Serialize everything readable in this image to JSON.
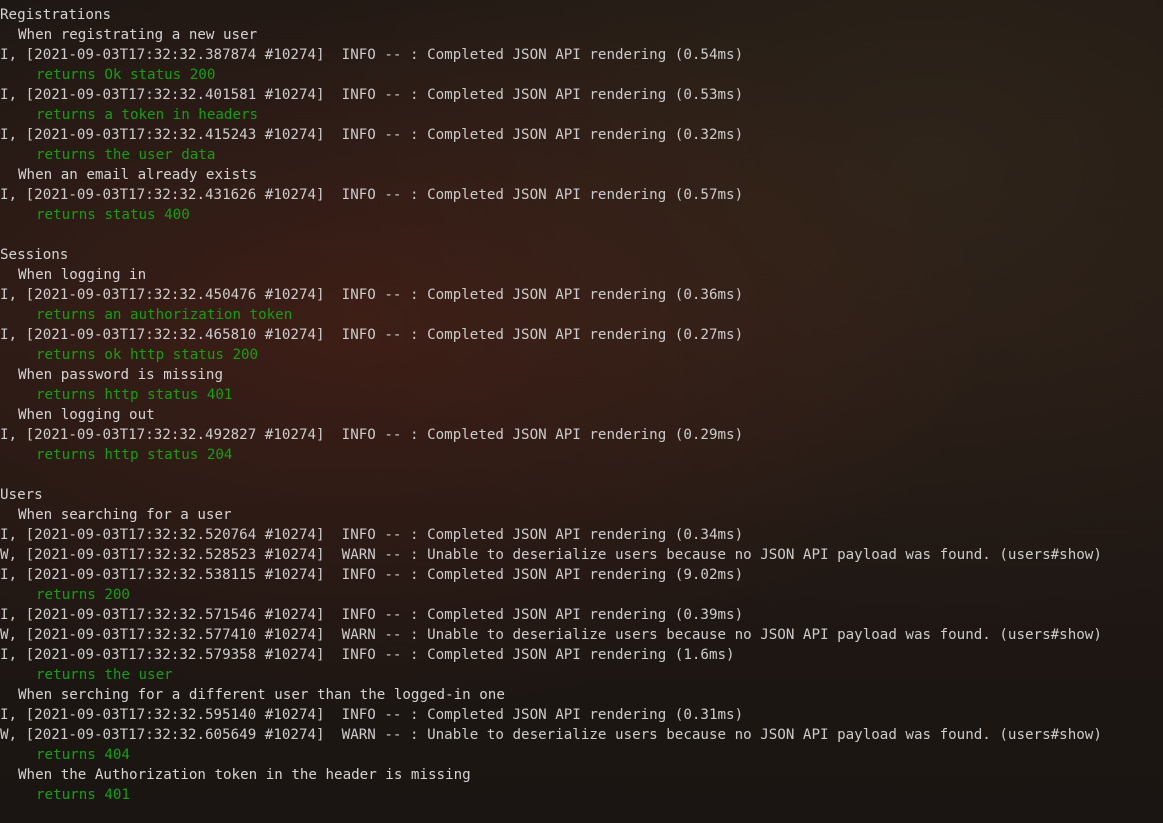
{
  "colors": {
    "background": "#1b1612",
    "text": "#cccccc",
    "pass": "#13a10e"
  },
  "lines": [
    {
      "kind": "suite",
      "text": "Registrations"
    },
    {
      "kind": "context",
      "text": "When registrating a new user"
    },
    {
      "kind": "log",
      "text": "I, [2021-09-03T17:32:32.387874 #10274]  INFO -- : Completed JSON API rendering (0.54ms)"
    },
    {
      "kind": "pass",
      "text": "returns Ok status 200"
    },
    {
      "kind": "log",
      "text": "I, [2021-09-03T17:32:32.401581 #10274]  INFO -- : Completed JSON API rendering (0.53ms)"
    },
    {
      "kind": "pass",
      "text": "returns a token in headers"
    },
    {
      "kind": "log",
      "text": "I, [2021-09-03T17:32:32.415243 #10274]  INFO -- : Completed JSON API rendering (0.32ms)"
    },
    {
      "kind": "pass",
      "text": "returns the user data"
    },
    {
      "kind": "context",
      "text": "When an email already exists"
    },
    {
      "kind": "log",
      "text": "I, [2021-09-03T17:32:32.431626 #10274]  INFO -- : Completed JSON API rendering (0.57ms)"
    },
    {
      "kind": "pass",
      "text": "returns status 400"
    },
    {
      "kind": "blank",
      "text": ""
    },
    {
      "kind": "suite",
      "text": "Sessions"
    },
    {
      "kind": "context",
      "text": "When logging in"
    },
    {
      "kind": "log",
      "text": "I, [2021-09-03T17:32:32.450476 #10274]  INFO -- : Completed JSON API rendering (0.36ms)"
    },
    {
      "kind": "pass",
      "text": "returns an authorization token"
    },
    {
      "kind": "log",
      "text": "I, [2021-09-03T17:32:32.465810 #10274]  INFO -- : Completed JSON API rendering (0.27ms)"
    },
    {
      "kind": "pass",
      "text": "returns ok http status 200"
    },
    {
      "kind": "context",
      "text": "When password is missing"
    },
    {
      "kind": "pass",
      "text": "returns http status 401"
    },
    {
      "kind": "context",
      "text": "When logging out"
    },
    {
      "kind": "log",
      "text": "I, [2021-09-03T17:32:32.492827 #10274]  INFO -- : Completed JSON API rendering (0.29ms)"
    },
    {
      "kind": "pass",
      "text": "returns http status 204"
    },
    {
      "kind": "blank",
      "text": ""
    },
    {
      "kind": "suite",
      "text": "Users"
    },
    {
      "kind": "context",
      "text": "When searching for a user"
    },
    {
      "kind": "log",
      "text": "I, [2021-09-03T17:32:32.520764 #10274]  INFO -- : Completed JSON API rendering (0.34ms)"
    },
    {
      "kind": "log",
      "text": "W, [2021-09-03T17:32:32.528523 #10274]  WARN -- : Unable to deserialize users because no JSON API payload was found. (users#show)"
    },
    {
      "kind": "log",
      "text": "I, [2021-09-03T17:32:32.538115 #10274]  INFO -- : Completed JSON API rendering (9.02ms)"
    },
    {
      "kind": "pass",
      "text": "returns 200"
    },
    {
      "kind": "log",
      "text": "I, [2021-09-03T17:32:32.571546 #10274]  INFO -- : Completed JSON API rendering (0.39ms)"
    },
    {
      "kind": "log",
      "text": "W, [2021-09-03T17:32:32.577410 #10274]  WARN -- : Unable to deserialize users because no JSON API payload was found. (users#show)"
    },
    {
      "kind": "log",
      "text": "I, [2021-09-03T17:32:32.579358 #10274]  INFO -- : Completed JSON API rendering (1.6ms)"
    },
    {
      "kind": "pass",
      "text": "returns the user"
    },
    {
      "kind": "context",
      "text": "When serching for a different user than the logged-in one"
    },
    {
      "kind": "log",
      "text": "I, [2021-09-03T17:32:32.595140 #10274]  INFO -- : Completed JSON API rendering (0.31ms)"
    },
    {
      "kind": "log",
      "text": "W, [2021-09-03T17:32:32.605649 #10274]  WARN -- : Unable to deserialize users because no JSON API payload was found. (users#show)"
    },
    {
      "kind": "pass",
      "text": "returns 404"
    },
    {
      "kind": "context",
      "text": "When the Authorization token in the header is missing"
    },
    {
      "kind": "pass",
      "text": "returns 401"
    }
  ]
}
